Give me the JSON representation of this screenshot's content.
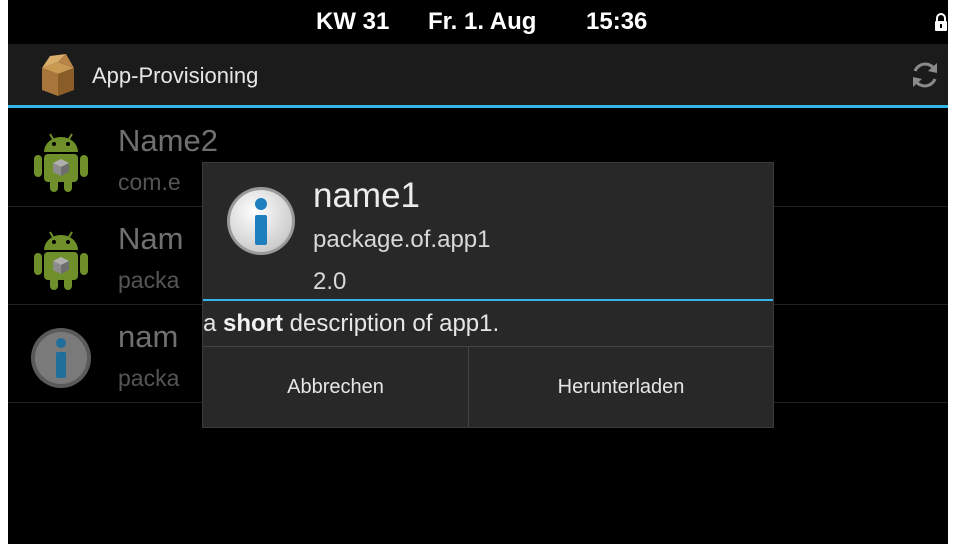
{
  "status_bar": {
    "week": "KW 31",
    "date": "Fr. 1. Aug",
    "time": "15:36",
    "lock_icon": "lock-icon"
  },
  "action_bar": {
    "app_icon": "package-box-icon",
    "title": "App-Provisioning",
    "refresh_icon": "refresh-icon"
  },
  "list": {
    "items": [
      {
        "icon": "android-icon",
        "title": "Name2",
        "subtitle": "com.e"
      },
      {
        "icon": "android-icon",
        "title": "Nam",
        "subtitle": "packa"
      },
      {
        "icon": "info-icon",
        "title": "nam",
        "subtitle": "packa"
      }
    ]
  },
  "dialog": {
    "icon": "info-icon",
    "title": "name1",
    "package": "package.of.app1",
    "version": "2.0",
    "description": {
      "prefix": "a ",
      "bold": "short",
      "suffix": " description of app1."
    },
    "buttons": {
      "cancel": "Abbrechen",
      "download": "Herunterladen"
    }
  },
  "colors": {
    "accent": "#33b5e5",
    "background": "#000000",
    "dialog_bg": "#282828"
  }
}
